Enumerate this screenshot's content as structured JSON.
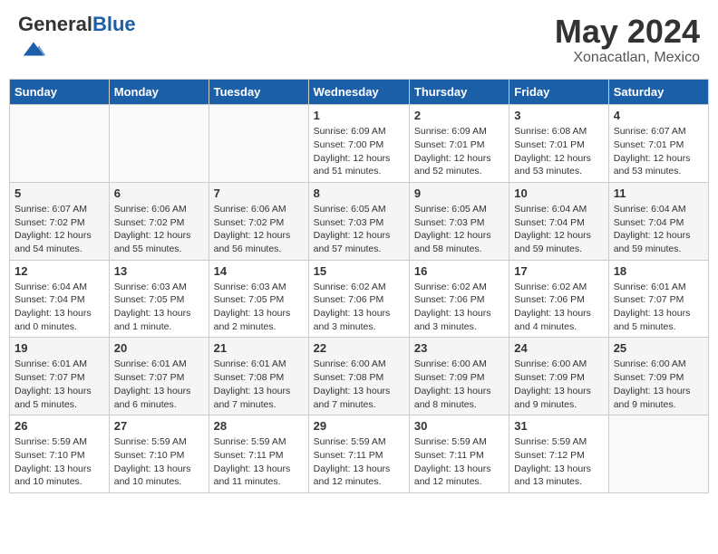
{
  "header": {
    "logo_general": "General",
    "logo_blue": "Blue",
    "title": "May 2024",
    "location": "Xonacatlan, Mexico"
  },
  "days_of_week": [
    "Sunday",
    "Monday",
    "Tuesday",
    "Wednesday",
    "Thursday",
    "Friday",
    "Saturday"
  ],
  "weeks": [
    [
      {
        "day": "",
        "info": ""
      },
      {
        "day": "",
        "info": ""
      },
      {
        "day": "",
        "info": ""
      },
      {
        "day": "1",
        "info": "Sunrise: 6:09 AM\nSunset: 7:00 PM\nDaylight: 12 hours\nand 51 minutes."
      },
      {
        "day": "2",
        "info": "Sunrise: 6:09 AM\nSunset: 7:01 PM\nDaylight: 12 hours\nand 52 minutes."
      },
      {
        "day": "3",
        "info": "Sunrise: 6:08 AM\nSunset: 7:01 PM\nDaylight: 12 hours\nand 53 minutes."
      },
      {
        "day": "4",
        "info": "Sunrise: 6:07 AM\nSunset: 7:01 PM\nDaylight: 12 hours\nand 53 minutes."
      }
    ],
    [
      {
        "day": "5",
        "info": "Sunrise: 6:07 AM\nSunset: 7:02 PM\nDaylight: 12 hours\nand 54 minutes."
      },
      {
        "day": "6",
        "info": "Sunrise: 6:06 AM\nSunset: 7:02 PM\nDaylight: 12 hours\nand 55 minutes."
      },
      {
        "day": "7",
        "info": "Sunrise: 6:06 AM\nSunset: 7:02 PM\nDaylight: 12 hours\nand 56 minutes."
      },
      {
        "day": "8",
        "info": "Sunrise: 6:05 AM\nSunset: 7:03 PM\nDaylight: 12 hours\nand 57 minutes."
      },
      {
        "day": "9",
        "info": "Sunrise: 6:05 AM\nSunset: 7:03 PM\nDaylight: 12 hours\nand 58 minutes."
      },
      {
        "day": "10",
        "info": "Sunrise: 6:04 AM\nSunset: 7:04 PM\nDaylight: 12 hours\nand 59 minutes."
      },
      {
        "day": "11",
        "info": "Sunrise: 6:04 AM\nSunset: 7:04 PM\nDaylight: 12 hours\nand 59 minutes."
      }
    ],
    [
      {
        "day": "12",
        "info": "Sunrise: 6:04 AM\nSunset: 7:04 PM\nDaylight: 13 hours\nand 0 minutes."
      },
      {
        "day": "13",
        "info": "Sunrise: 6:03 AM\nSunset: 7:05 PM\nDaylight: 13 hours\nand 1 minute."
      },
      {
        "day": "14",
        "info": "Sunrise: 6:03 AM\nSunset: 7:05 PM\nDaylight: 13 hours\nand 2 minutes."
      },
      {
        "day": "15",
        "info": "Sunrise: 6:02 AM\nSunset: 7:06 PM\nDaylight: 13 hours\nand 3 minutes."
      },
      {
        "day": "16",
        "info": "Sunrise: 6:02 AM\nSunset: 7:06 PM\nDaylight: 13 hours\nand 3 minutes."
      },
      {
        "day": "17",
        "info": "Sunrise: 6:02 AM\nSunset: 7:06 PM\nDaylight: 13 hours\nand 4 minutes."
      },
      {
        "day": "18",
        "info": "Sunrise: 6:01 AM\nSunset: 7:07 PM\nDaylight: 13 hours\nand 5 minutes."
      }
    ],
    [
      {
        "day": "19",
        "info": "Sunrise: 6:01 AM\nSunset: 7:07 PM\nDaylight: 13 hours\nand 5 minutes."
      },
      {
        "day": "20",
        "info": "Sunrise: 6:01 AM\nSunset: 7:07 PM\nDaylight: 13 hours\nand 6 minutes."
      },
      {
        "day": "21",
        "info": "Sunrise: 6:01 AM\nSunset: 7:08 PM\nDaylight: 13 hours\nand 7 minutes."
      },
      {
        "day": "22",
        "info": "Sunrise: 6:00 AM\nSunset: 7:08 PM\nDaylight: 13 hours\nand 7 minutes."
      },
      {
        "day": "23",
        "info": "Sunrise: 6:00 AM\nSunset: 7:09 PM\nDaylight: 13 hours\nand 8 minutes."
      },
      {
        "day": "24",
        "info": "Sunrise: 6:00 AM\nSunset: 7:09 PM\nDaylight: 13 hours\nand 9 minutes."
      },
      {
        "day": "25",
        "info": "Sunrise: 6:00 AM\nSunset: 7:09 PM\nDaylight: 13 hours\nand 9 minutes."
      }
    ],
    [
      {
        "day": "26",
        "info": "Sunrise: 5:59 AM\nSunset: 7:10 PM\nDaylight: 13 hours\nand 10 minutes."
      },
      {
        "day": "27",
        "info": "Sunrise: 5:59 AM\nSunset: 7:10 PM\nDaylight: 13 hours\nand 10 minutes."
      },
      {
        "day": "28",
        "info": "Sunrise: 5:59 AM\nSunset: 7:11 PM\nDaylight: 13 hours\nand 11 minutes."
      },
      {
        "day": "29",
        "info": "Sunrise: 5:59 AM\nSunset: 7:11 PM\nDaylight: 13 hours\nand 12 minutes."
      },
      {
        "day": "30",
        "info": "Sunrise: 5:59 AM\nSunset: 7:11 PM\nDaylight: 13 hours\nand 12 minutes."
      },
      {
        "day": "31",
        "info": "Sunrise: 5:59 AM\nSunset: 7:12 PM\nDaylight: 13 hours\nand 13 minutes."
      },
      {
        "day": "",
        "info": ""
      }
    ]
  ]
}
